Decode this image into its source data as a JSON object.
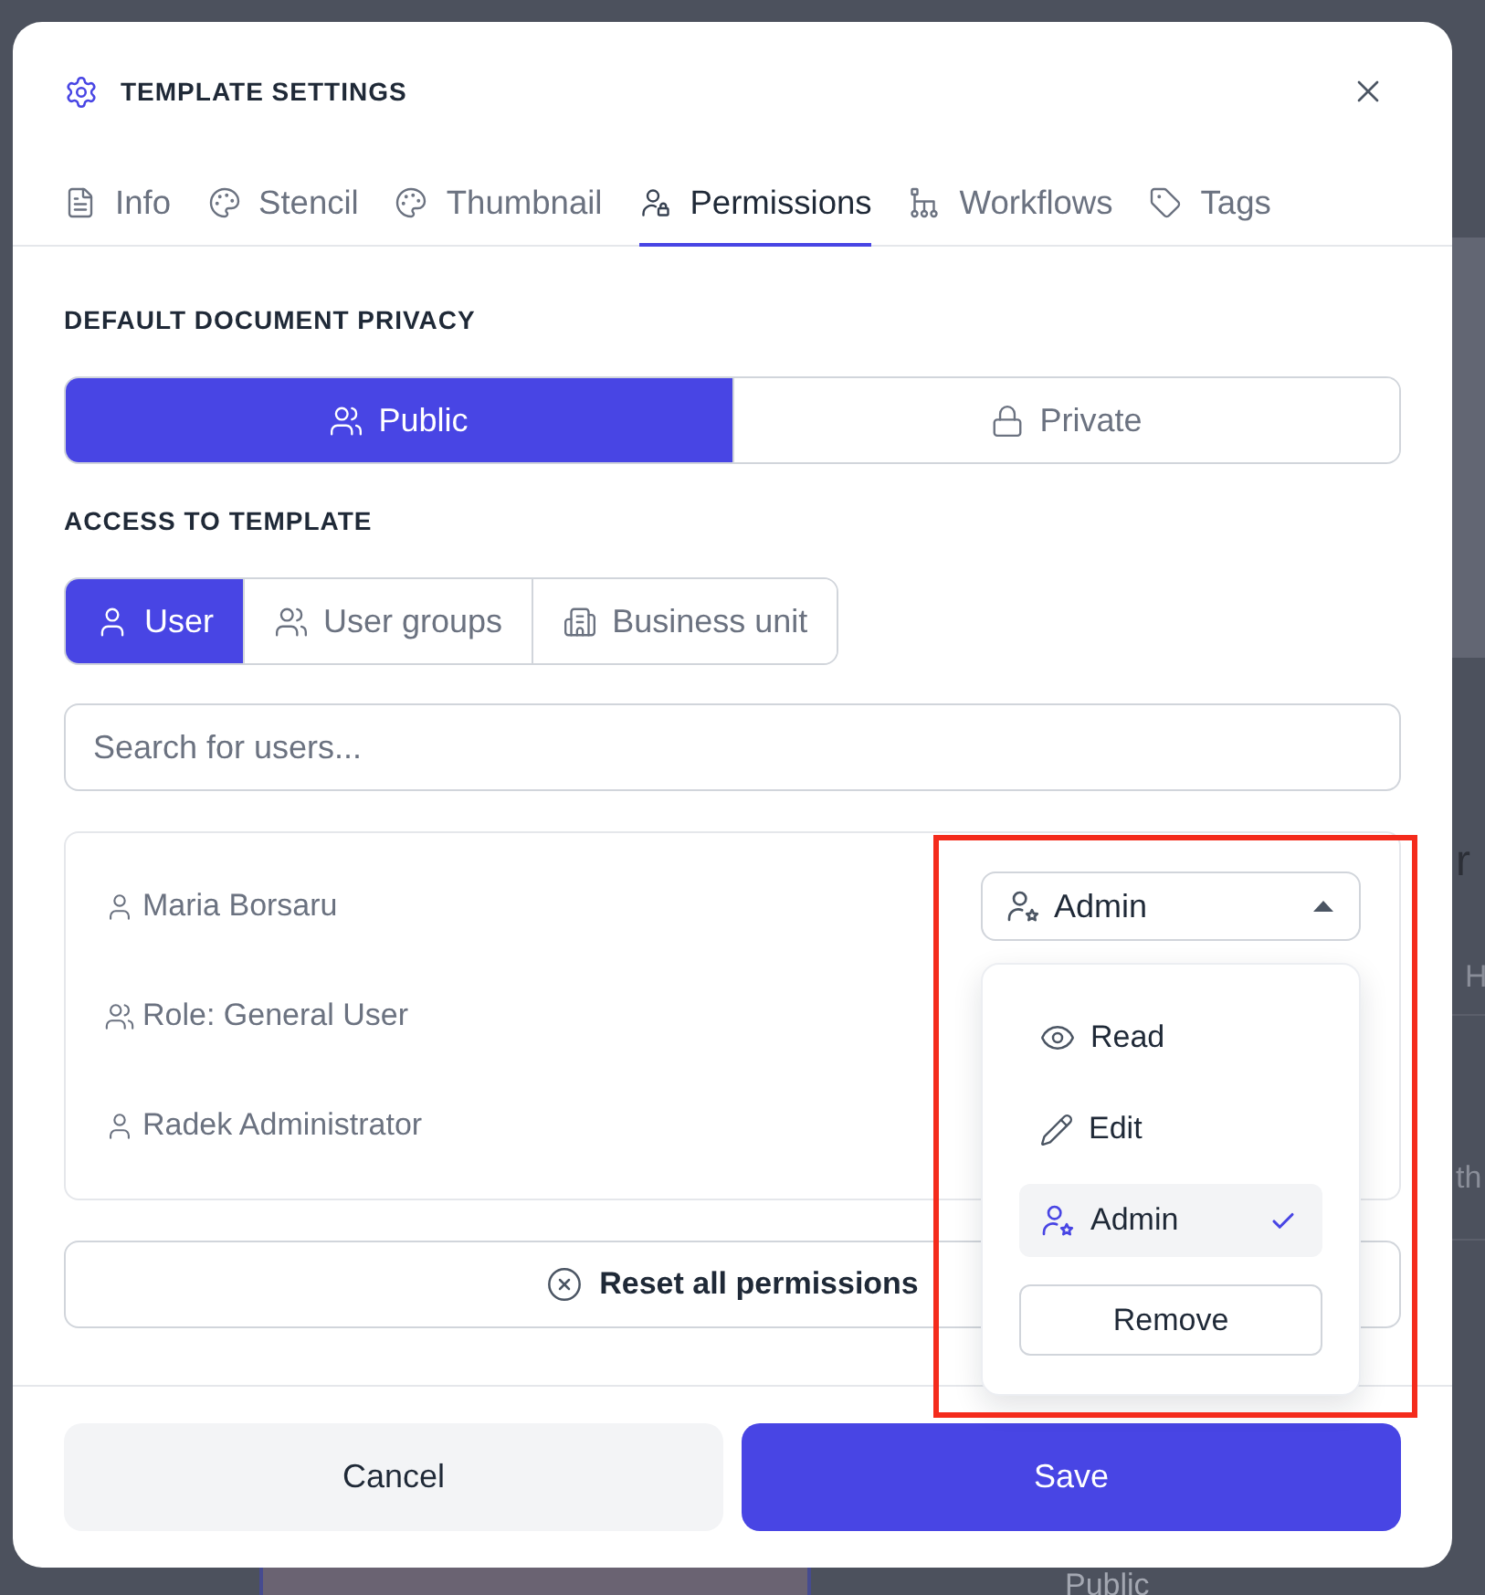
{
  "dialog": {
    "title": "TEMPLATE SETTINGS"
  },
  "tabs": [
    {
      "label": "Info",
      "selected": false
    },
    {
      "label": "Stencil",
      "selected": false
    },
    {
      "label": "Thumbnail",
      "selected": false
    },
    {
      "label": "Permissions",
      "selected": true
    },
    {
      "label": "Workflows",
      "selected": false
    },
    {
      "label": "Tags",
      "selected": false
    }
  ],
  "privacy": {
    "label": "DEFAULT DOCUMENT PRIVACY",
    "options": [
      {
        "label": "Public",
        "selected": true
      },
      {
        "label": "Private",
        "selected": false
      }
    ]
  },
  "access": {
    "label": "ACCESS TO TEMPLATE",
    "options": [
      {
        "label": "User",
        "selected": true
      },
      {
        "label": "User groups",
        "selected": false
      },
      {
        "label": "Business unit",
        "selected": false
      }
    ],
    "search": {
      "placeholder": "Search for users..."
    },
    "entries": [
      {
        "name": "Maria Borsaru",
        "kind": "user",
        "permission": {
          "value": "Admin",
          "kind": "admin",
          "expanded": true,
          "menu": {
            "options": [
              {
                "label": "Read",
                "kind": "read",
                "selected": false
              },
              {
                "label": "Edit",
                "kind": "edit",
                "selected": false
              },
              {
                "label": "Admin",
                "kind": "admin",
                "selected": true
              }
            ],
            "remove": "Remove"
          }
        }
      },
      {
        "name": "Role: General User",
        "kind": "role"
      },
      {
        "name": "Radek Administrator",
        "kind": "user"
      }
    ]
  },
  "reset_button": "Reset all permissions",
  "footer": {
    "cancel": "Cancel",
    "save": "Save"
  },
  "background": {
    "texts": [
      "r",
      "H",
      "th",
      "Public"
    ]
  }
}
